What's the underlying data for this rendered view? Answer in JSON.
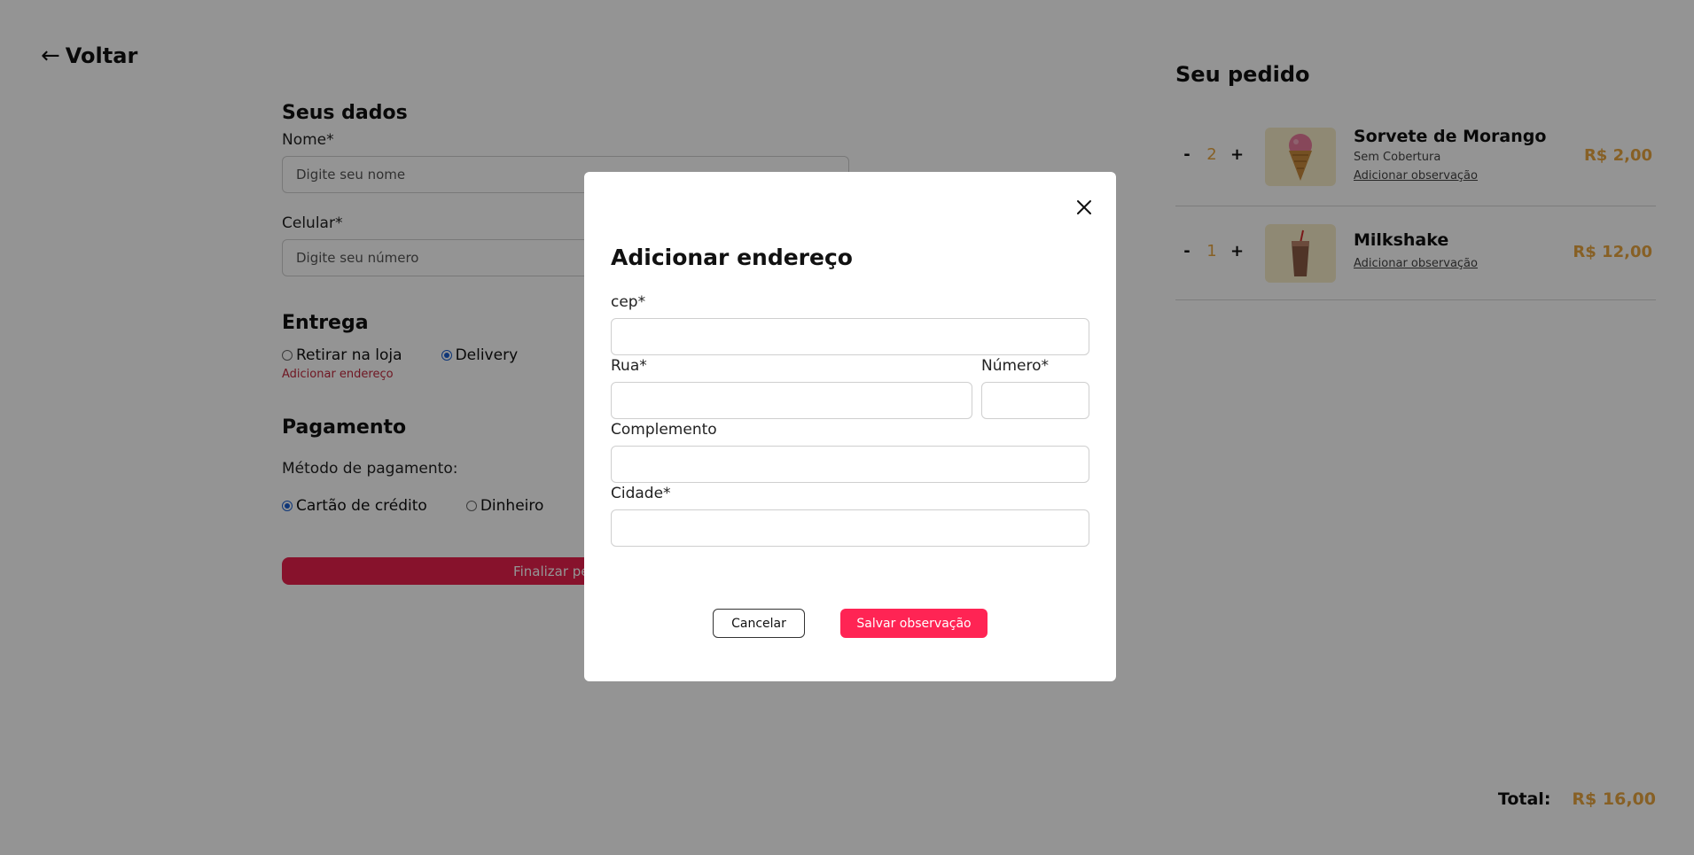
{
  "back": {
    "arrow": "←",
    "label": "Voltar"
  },
  "form": {
    "personal": {
      "title": "Seus dados",
      "name_label": "Nome*",
      "name_placeholder": "Digite seu nome",
      "phone_label": "Celular*",
      "phone_placeholder": "Digite seu número"
    },
    "delivery": {
      "title": "Entrega",
      "option_pickup": "Retirar na loja",
      "option_delivery": "Delivery",
      "selected": "Delivery",
      "add_address": "Adicionar endereço"
    },
    "payment": {
      "title": "Pagamento",
      "method_label": "Método de pagamento:",
      "option_card": "Cartão de crédito",
      "option_cash": "Dinheiro",
      "selected": "Cartão de crédito"
    },
    "finalize_label": "Finalizar pedido"
  },
  "order": {
    "title": "Seu pedido",
    "items": [
      {
        "name": "Sorvete de Morango",
        "subtitle": "Sem Cobertura",
        "observation_link": "Adicionar observação",
        "quantity": "2",
        "price": "R$ 2,00",
        "minus": "-",
        "plus": "+",
        "icon": "ice-cream-cone-icon"
      },
      {
        "name": "Milkshake",
        "observation_link": "Adicionar observação",
        "quantity": "1",
        "price": "R$ 12,00",
        "minus": "-",
        "plus": "+",
        "icon": "milkshake-icon"
      }
    ],
    "total_label": "Total:",
    "total_value": "R$ 16,00"
  },
  "modal": {
    "title": "Adicionar endereço",
    "cep_label": "cep*",
    "street_label": "Rua*",
    "number_label": "Número*",
    "complement_label": "Complemento",
    "city_label": "Cidade*",
    "cep_value": "",
    "street_value": "",
    "number_value": "",
    "complement_value": "",
    "city_value": "",
    "cancel_label": "Cancelar",
    "save_label": "Salvar observação"
  },
  "colors": {
    "accent_red": "#ff2454",
    "price_gold": "#e8a640",
    "thumb_bg": "#f6ecc9",
    "link_red": "#c0283d",
    "radio_blue": "#1a5fd0",
    "overlay": "rgba(0,0,0,0.42)"
  }
}
